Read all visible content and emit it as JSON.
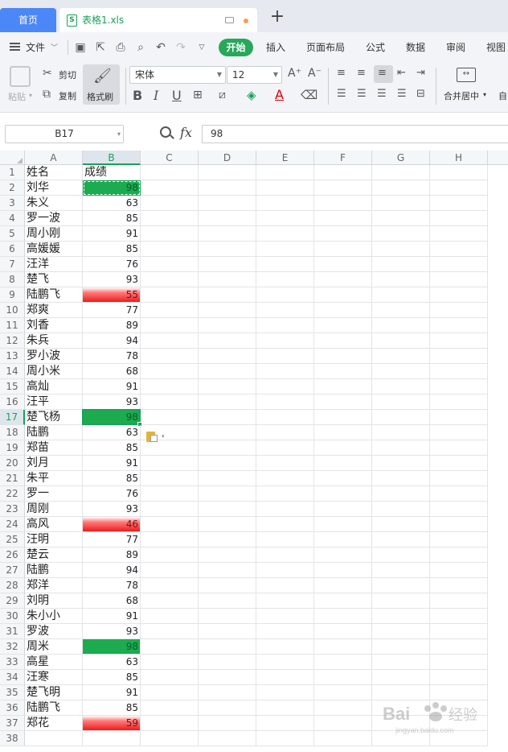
{
  "tabs": {
    "home": "首页",
    "file": "表格1.xls"
  },
  "menu": {
    "file": "文件",
    "tabs": [
      "开始",
      "插入",
      "页面布局",
      "公式",
      "数据",
      "审阅",
      "视图"
    ]
  },
  "ribbon": {
    "paste": "粘贴",
    "cut": "剪切",
    "copy": "复制",
    "format_painter": "格式刷",
    "font_name": "宋体",
    "font_size": "12",
    "merge_center": "合并居中",
    "auto_wrap_fragment": "自"
  },
  "formula_bar": {
    "cell_ref": "B17",
    "fx": "fx",
    "value": "98"
  },
  "sheet": {
    "columns": [
      "A",
      "B",
      "C",
      "D",
      "E",
      "F",
      "G",
      "H"
    ],
    "rows": [
      {
        "n": "1",
        "name": "姓名",
        "score": "成绩",
        "fill": "none"
      },
      {
        "n": "2",
        "name": "刘华",
        "score": "98",
        "fill": "green"
      },
      {
        "n": "3",
        "name": "朱义",
        "score": "63",
        "fill": "none"
      },
      {
        "n": "4",
        "name": "罗一波",
        "score": "85",
        "fill": "none"
      },
      {
        "n": "5",
        "name": "周小刚",
        "score": "91",
        "fill": "none"
      },
      {
        "n": "6",
        "name": "高媛媛",
        "score": "85",
        "fill": "none"
      },
      {
        "n": "7",
        "name": "汪洋",
        "score": "76",
        "fill": "none"
      },
      {
        "n": "8",
        "name": "楚飞",
        "score": "93",
        "fill": "none"
      },
      {
        "n": "9",
        "name": "陆鹏飞",
        "score": "55",
        "fill": "red"
      },
      {
        "n": "10",
        "name": "郑爽",
        "score": "77",
        "fill": "none"
      },
      {
        "n": "11",
        "name": "刘香",
        "score": "89",
        "fill": "none"
      },
      {
        "n": "12",
        "name": "朱兵",
        "score": "94",
        "fill": "none"
      },
      {
        "n": "13",
        "name": "罗小波",
        "score": "78",
        "fill": "none"
      },
      {
        "n": "14",
        "name": "周小米",
        "score": "68",
        "fill": "none"
      },
      {
        "n": "15",
        "name": "高灿",
        "score": "91",
        "fill": "none"
      },
      {
        "n": "16",
        "name": "汪平",
        "score": "93",
        "fill": "none"
      },
      {
        "n": "17",
        "name": "楚飞杨",
        "score": "98",
        "fill": "green"
      },
      {
        "n": "18",
        "name": "陆鹏",
        "score": "63",
        "fill": "none"
      },
      {
        "n": "19",
        "name": "郑苗",
        "score": "85",
        "fill": "none"
      },
      {
        "n": "20",
        "name": "刘月",
        "score": "91",
        "fill": "none"
      },
      {
        "n": "21",
        "name": "朱平",
        "score": "85",
        "fill": "none"
      },
      {
        "n": "22",
        "name": "罗一",
        "score": "76",
        "fill": "none"
      },
      {
        "n": "23",
        "name": "周刚",
        "score": "93",
        "fill": "none"
      },
      {
        "n": "24",
        "name": "高风",
        "score": "46",
        "fill": "red"
      },
      {
        "n": "25",
        "name": "汪明",
        "score": "77",
        "fill": "none"
      },
      {
        "n": "26",
        "name": "楚云",
        "score": "89",
        "fill": "none"
      },
      {
        "n": "27",
        "name": "陆鹏",
        "score": "94",
        "fill": "none"
      },
      {
        "n": "28",
        "name": "郑洋",
        "score": "78",
        "fill": "none"
      },
      {
        "n": "29",
        "name": "刘明",
        "score": "68",
        "fill": "none"
      },
      {
        "n": "30",
        "name": "朱小小",
        "score": "91",
        "fill": "none"
      },
      {
        "n": "31",
        "name": "罗波",
        "score": "93",
        "fill": "none"
      },
      {
        "n": "32",
        "name": "周米",
        "score": "98",
        "fill": "green"
      },
      {
        "n": "33",
        "name": "高星",
        "score": "63",
        "fill": "none"
      },
      {
        "n": "34",
        "name": "汪寒",
        "score": "85",
        "fill": "none"
      },
      {
        "n": "35",
        "name": "楚飞明",
        "score": "91",
        "fill": "none"
      },
      {
        "n": "36",
        "name": "陆鹏飞",
        "score": "85",
        "fill": "none"
      },
      {
        "n": "37",
        "name": "郑花",
        "score": "59",
        "fill": "red"
      },
      {
        "n": "38",
        "name": "",
        "score": "",
        "fill": "none"
      }
    ],
    "active_cell": "B17",
    "copy_cell": "B2"
  },
  "colors": {
    "accent": "#1aa15c",
    "highlight_green": "#1cab4f",
    "highlight_red": "#ee1c1c",
    "home_tab": "#4b87f7"
  },
  "watermark": "Baidu经验"
}
